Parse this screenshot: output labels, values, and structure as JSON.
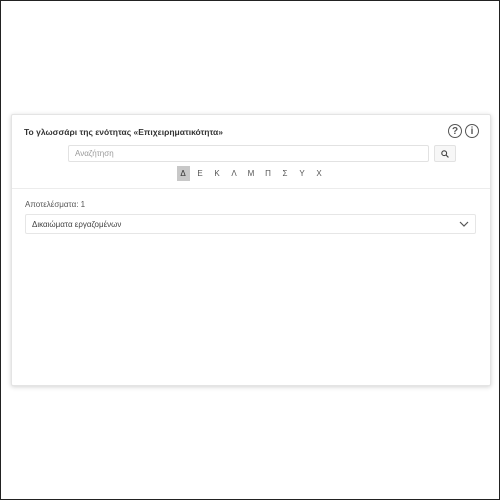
{
  "glossary": {
    "title": "Το γλωσσάρι της ενότητας «Επιχειρηματικότητα»",
    "search": {
      "placeholder": "Αναζήτηση"
    },
    "letters": [
      "Δ",
      "Ε",
      "Κ",
      "Λ",
      "Μ",
      "Π",
      "Σ",
      "Υ",
      "Χ"
    ],
    "active_letter": "Δ",
    "results_label": "Αποτελέσματα: 1",
    "results": [
      {
        "label": "Δικαιώματα εργαζομένων"
      }
    ]
  },
  "icons": {
    "help": "help-icon",
    "info": "info-icon",
    "search": "search-icon",
    "expand": "chevron-down-icon"
  }
}
